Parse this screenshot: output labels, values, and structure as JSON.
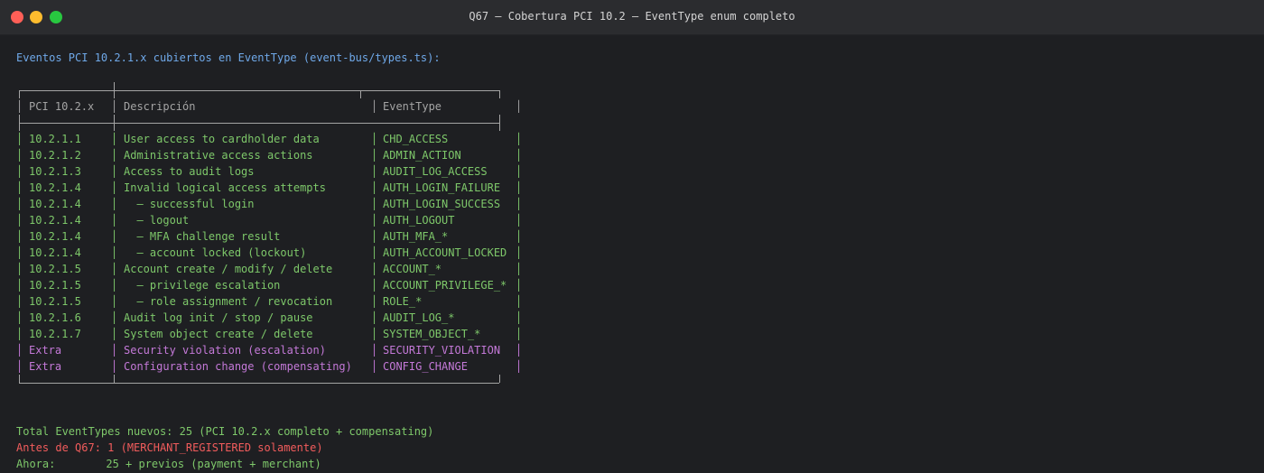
{
  "window": {
    "title": "Q67 — Cobertura PCI 10.2 — EventType enum completo"
  },
  "colors": {
    "background": "#1e1f22",
    "titlebar": "#2b2c2f",
    "heading": "#6fa8e8",
    "pci_rows": "#7ec86a",
    "extra_rows": "#c479d8",
    "warning": "#f25c5c",
    "border": "#a4a4a4"
  },
  "terminal": {
    "heading": "Eventos PCI 10.2.1.x cubiertos en EventType (event-bus/types.ts):",
    "table": {
      "headers": [
        "PCI 10.2.x",
        "Descripción",
        "EventType"
      ],
      "rows": [
        {
          "pci": "10.2.1.1",
          "desc": "User access to cardholder data",
          "event": "CHD_ACCESS",
          "kind": "pci"
        },
        {
          "pci": "10.2.1.2",
          "desc": "Administrative access actions",
          "event": "ADMIN_ACTION",
          "kind": "pci"
        },
        {
          "pci": "10.2.1.3",
          "desc": "Access to audit logs",
          "event": "AUDIT_LOG_ACCESS",
          "kind": "pci"
        },
        {
          "pci": "10.2.1.4",
          "desc": "Invalid logical access attempts",
          "event": "AUTH_LOGIN_FAILURE",
          "kind": "pci"
        },
        {
          "pci": "10.2.1.4",
          "desc": "  — successful login",
          "event": "AUTH_LOGIN_SUCCESS",
          "kind": "pci"
        },
        {
          "pci": "10.2.1.4",
          "desc": "  — logout",
          "event": "AUTH_LOGOUT",
          "kind": "pci"
        },
        {
          "pci": "10.2.1.4",
          "desc": "  — MFA challenge result",
          "event": "AUTH_MFA_*",
          "kind": "pci"
        },
        {
          "pci": "10.2.1.4",
          "desc": "  — account locked (lockout)",
          "event": "AUTH_ACCOUNT_LOCKED",
          "kind": "pci"
        },
        {
          "pci": "10.2.1.5",
          "desc": "Account create / modify / delete",
          "event": "ACCOUNT_*",
          "kind": "pci"
        },
        {
          "pci": "10.2.1.5",
          "desc": "  — privilege escalation",
          "event": "ACCOUNT_PRIVILEGE_*",
          "kind": "pci"
        },
        {
          "pci": "10.2.1.5",
          "desc": "  — role assignment / revocation",
          "event": "ROLE_*",
          "kind": "pci"
        },
        {
          "pci": "10.2.1.6",
          "desc": "Audit log init / stop / pause",
          "event": "AUDIT_LOG_*",
          "kind": "pci"
        },
        {
          "pci": "10.2.1.7",
          "desc": "System object create / delete",
          "event": "SYSTEM_OBJECT_*",
          "kind": "pci"
        },
        {
          "pci": "Extra",
          "desc": "Security violation (escalation)",
          "event": "SECURITY_VIOLATION",
          "kind": "extra"
        },
        {
          "pci": "Extra",
          "desc": "Configuration change (compensating)",
          "event": "CONFIG_CHANGE",
          "kind": "extra"
        }
      ]
    },
    "summary": {
      "total": "Total EventTypes nuevos: 25 (PCI 10.2.x completo + compensating)",
      "before": "Antes de Q67: 1 (MERCHANT_REGISTERED solamente)",
      "now_label": "Ahora:",
      "now_value": "25 + previos (payment + merchant)"
    }
  }
}
